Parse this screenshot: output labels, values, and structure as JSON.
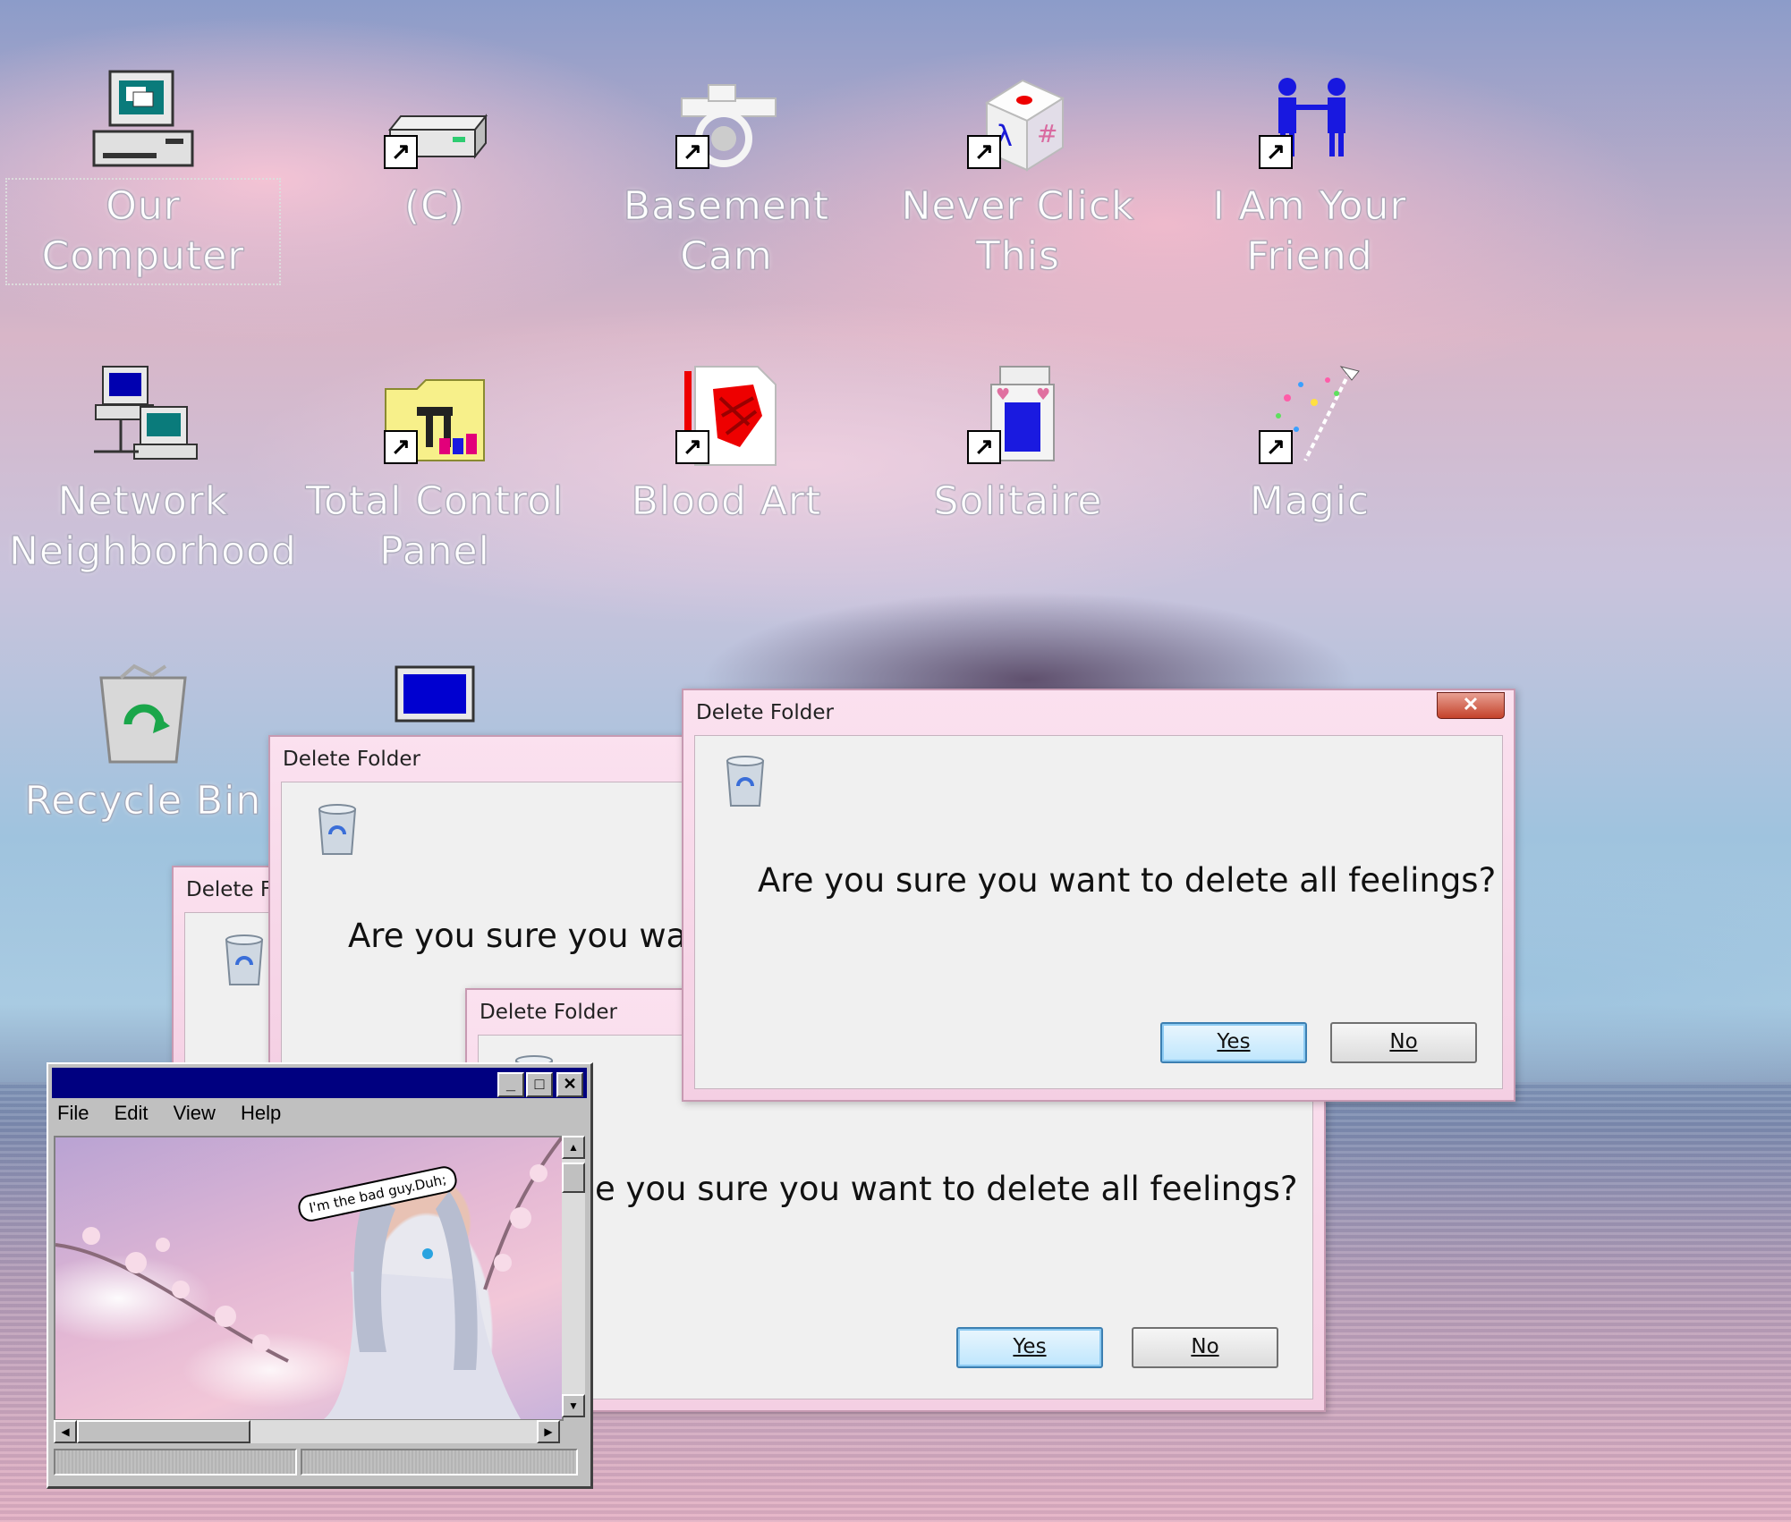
{
  "desktop": {
    "icons": [
      {
        "label": "Our Computer",
        "icon": "my-computer-icon"
      },
      {
        "label": "(C)",
        "icon": "drive-icon"
      },
      {
        "label": "Basement Cam",
        "icon": "camera-icon"
      },
      {
        "label": "Never Click This",
        "icon": "dice-icon"
      },
      {
        "label": "I Am Your Friend",
        "icon": "people-icon"
      },
      {
        "label": "Network Neighborhood",
        "icon": "network-icon"
      },
      {
        "label": "Total Control Panel",
        "icon": "control-panel-icon"
      },
      {
        "label": "Blood Art",
        "icon": "paint-icon"
      },
      {
        "label": "Solitaire",
        "icon": "solitaire-icon"
      },
      {
        "label": "Magic",
        "icon": "magic-wand-icon"
      },
      {
        "label": "Recycle Bin",
        "icon": "recycle-bin-icon"
      }
    ]
  },
  "dialogs": [
    {
      "title": "Delete Folder",
      "message": "Are you sure you want to delete all feelings?",
      "yes": "Yes",
      "no": "No"
    },
    {
      "title": "Delete Folder",
      "message": "Are you sure you wan"
    },
    {
      "title": "Delete Fo"
    },
    {
      "title": "Delete Folder",
      "message": "e you sure you want to delete all feelings?",
      "yes": "Yes",
      "no": "No"
    }
  ],
  "viewer": {
    "menu": [
      "File",
      "Edit",
      "View",
      "Help"
    ],
    "image_caption": "I'm the bad guy.Duh;"
  },
  "colors": {
    "titlebar": "#000080",
    "dialog_frame": "#f4cfe3"
  }
}
